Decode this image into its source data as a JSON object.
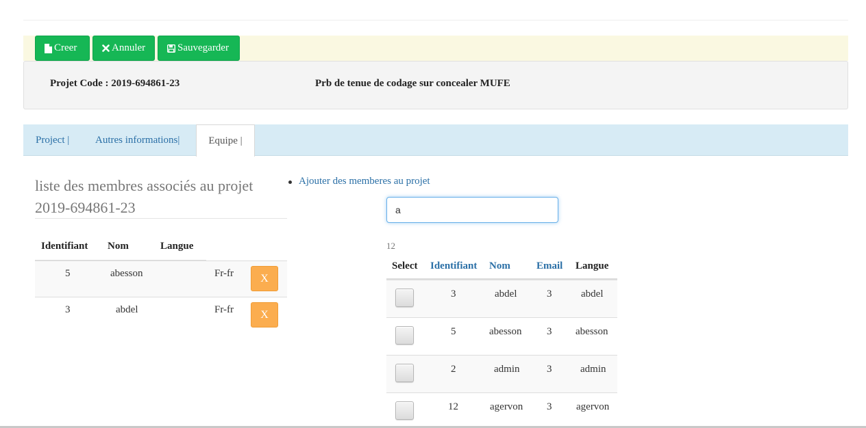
{
  "toolbar": {
    "create_label": "Creer",
    "cancel_label": "Annuler",
    "save_label": "Sauvegarder"
  },
  "project": {
    "code_label": "Projet Code : 2019-694861-23",
    "description": "Prb de tenue de codage sur concealer MUFE"
  },
  "tabs": [
    {
      "label": "Project |",
      "active": false
    },
    {
      "label": "Autres informations|",
      "active": false
    },
    {
      "label": "Equipe |",
      "active": true
    }
  ],
  "members": {
    "title": "liste des membres associés au projet 2019-694861-23",
    "columns": [
      "Identifiant",
      "Nom",
      "Langue"
    ],
    "rows": [
      {
        "id": "5",
        "name": "abesson",
        "lang": "Fr-fr",
        "remove_label": "X"
      },
      {
        "id": "3",
        "name": "abdel",
        "lang": "Fr-fr",
        "remove_label": "X"
      }
    ]
  },
  "add": {
    "link_label": "Ajouter des memberes au projet",
    "search_value": "a",
    "result_count": "12",
    "columns": [
      "Select",
      "Identifiant",
      "Nom",
      "Email",
      "Langue"
    ],
    "rows": [
      {
        "id": "3",
        "name": "abdel",
        "email": "3",
        "lang": "abdel"
      },
      {
        "id": "5",
        "name": "abesson",
        "email": "3",
        "lang": "abesson"
      },
      {
        "id": "2",
        "name": "admin",
        "email": "3",
        "lang": "admin"
      },
      {
        "id": "12",
        "name": "agervon",
        "email": "3",
        "lang": "agervon"
      }
    ]
  },
  "colors": {
    "primary_button": "#16b755",
    "warning_button": "#fbad4f",
    "link": "#2a6fa6",
    "tab_bar": "#d7ebf5",
    "toolbar_bg": "#faf8e1"
  }
}
